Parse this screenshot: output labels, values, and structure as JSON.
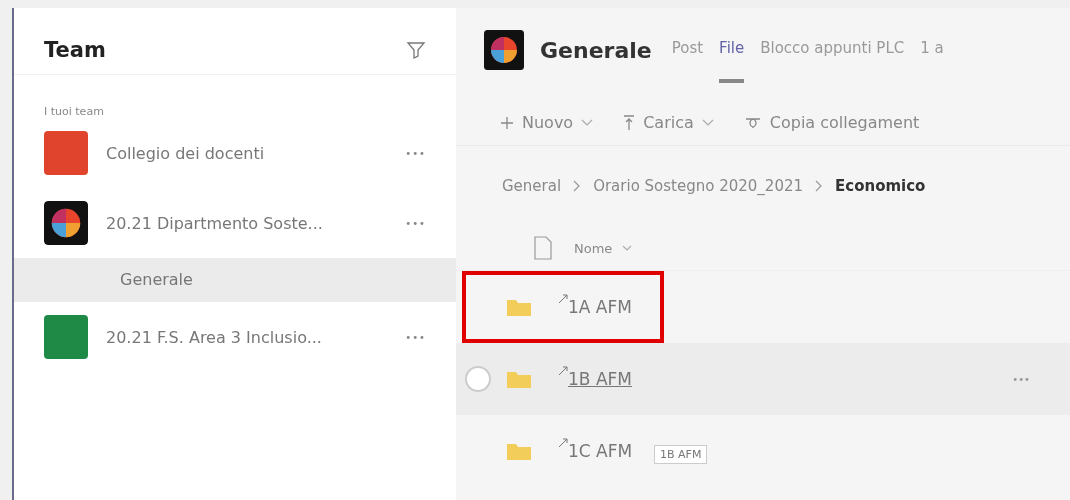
{
  "sidebar": {
    "title": "Team",
    "section": "I tuoi team",
    "teams": [
      {
        "name": "Collegio dei docenti",
        "kind": "initial",
        "color": "#e0442c",
        "menu": "•••"
      },
      {
        "name": "20.21 Dipartmento Soste...",
        "kind": "picture",
        "menu": "•••",
        "channels": [
          {
            "name": "Generale",
            "selected": true
          }
        ]
      },
      {
        "name": "20.21 F.S. Area 3 Inclusio...",
        "kind": "initial",
        "color": "#1e8a45",
        "menu": "•••"
      }
    ]
  },
  "header": {
    "title": "Generale",
    "tabs": [
      {
        "label": "Post",
        "selected": false
      },
      {
        "label": "File",
        "selected": true
      },
      {
        "label": "Blocco appunti PLC",
        "selected": false
      },
      {
        "label": "1 a",
        "selected": false
      }
    ]
  },
  "toolbar": [
    {
      "label": "Nuovo",
      "kind": "new"
    },
    {
      "label": "Carica",
      "kind": "upload"
    },
    {
      "label": "Copia collegament",
      "kind": "link"
    }
  ],
  "breadcrumb": [
    "General",
    "Orario Sostegno 2020_2021",
    "Economico"
  ],
  "table": {
    "column": "Nome",
    "rows": [
      {
        "name": "1A AFM",
        "highlighted": true,
        "hovered": false
      },
      {
        "name": "1B AFM",
        "highlighted": false,
        "hovered": true,
        "menu": "•••"
      },
      {
        "name": "1C AFM",
        "highlighted": false,
        "hovered": false
      }
    ]
  },
  "tooltip": "1B AFM"
}
